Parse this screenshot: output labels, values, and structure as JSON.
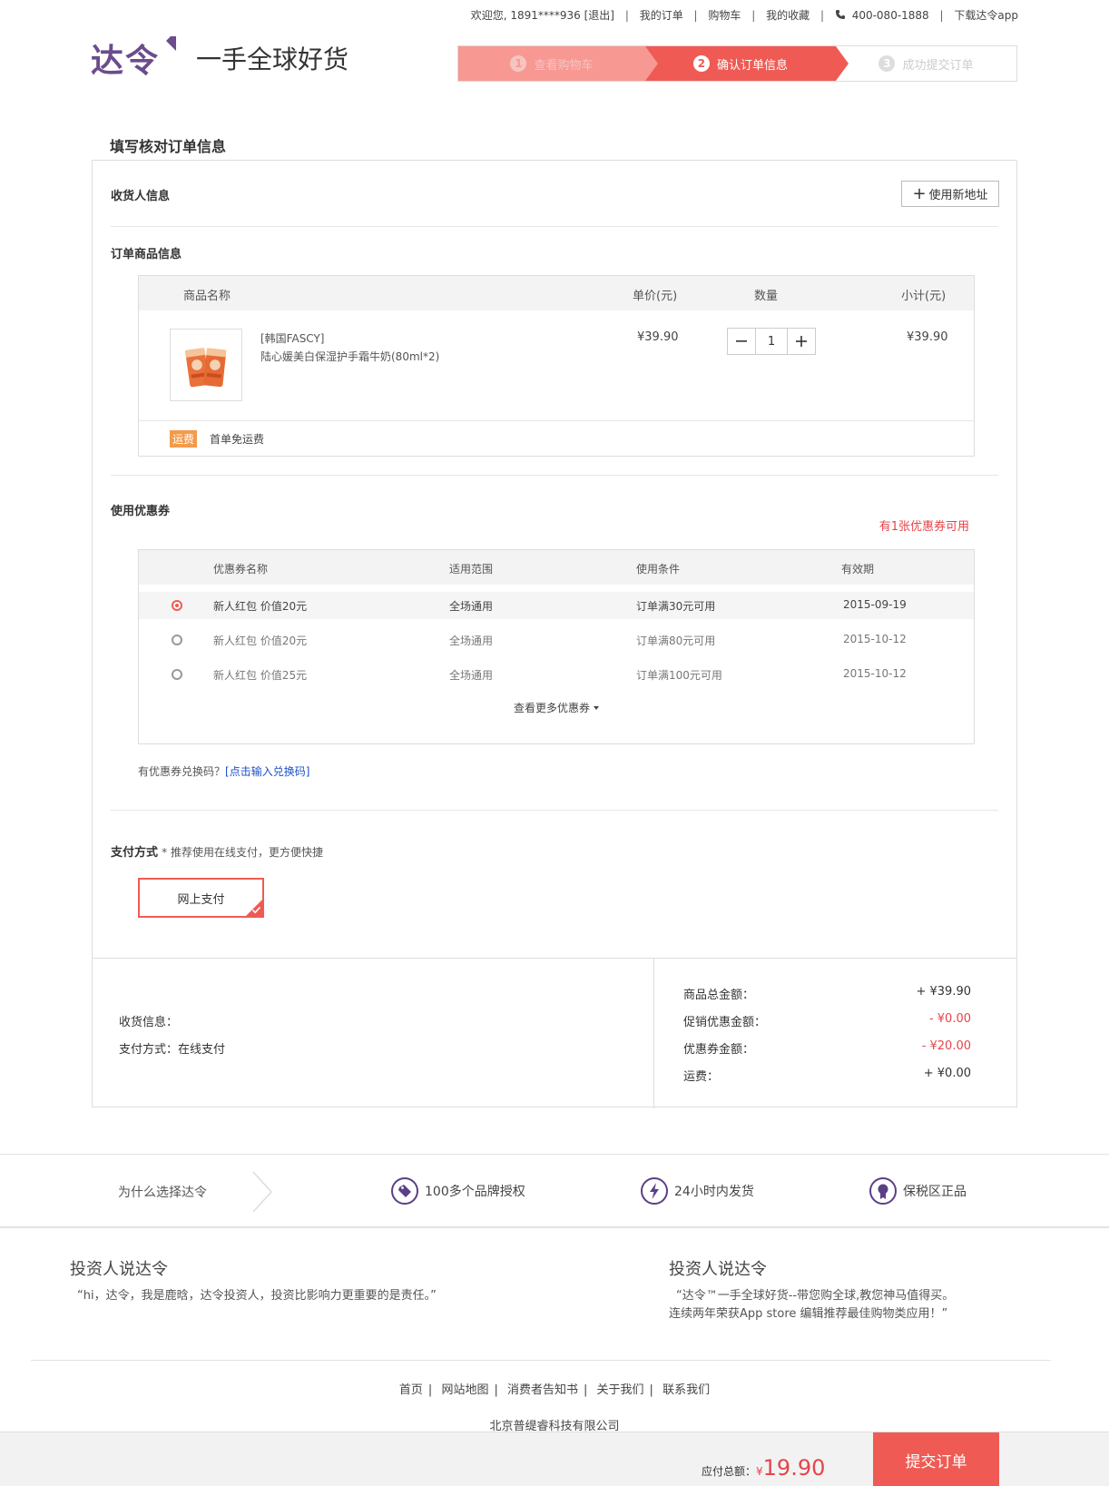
{
  "topbar": {
    "welcome": "欢迎您, 1891****936",
    "logout": "[退出]",
    "my_orders": "我的订单",
    "cart": "购物车",
    "favorites": "我的收藏",
    "phone": "400-080-1888",
    "download_app": "下载达令app"
  },
  "header": {
    "logo_text": "达令",
    "slogan": "一手全球好货",
    "steps": [
      {
        "num": "1",
        "label": "查看购物车",
        "state": "done"
      },
      {
        "num": "2",
        "label": "确认订单信息",
        "state": "active"
      },
      {
        "num": "3",
        "label": "成功提交订单",
        "state": "pending"
      }
    ]
  },
  "page_title": "填写核对订单信息",
  "consignee": {
    "label": "收货人信息",
    "new_address_button": "使用新地址"
  },
  "order_items": {
    "label": "订单商品信息",
    "columns": {
      "name": "商品名称",
      "price": "单价(元)",
      "qty": "数量",
      "subtotal": "小计(元)"
    },
    "items": [
      {
        "brand": "[韩国FASCY]",
        "name": "陆心媛美白保湿护手霜牛奶(80ml*2)",
        "price": "¥39.90",
        "qty": "1",
        "subtotal": "¥39.90"
      }
    ],
    "shipping_tag": "运费",
    "shipping_text": "首单免运费"
  },
  "coupons": {
    "label": "使用优惠券",
    "available": "有1张优惠券可用",
    "columns": {
      "name": "优惠券名称",
      "scope": "适用范围",
      "condition": "使用条件",
      "expiry": "有效期"
    },
    "rows": [
      {
        "name": "新人红包 价值20元",
        "scope": "全场通用",
        "condition": "订单满30元可用",
        "expiry": "2015-09-19",
        "selected": true
      },
      {
        "name": "新人红包 价值20元",
        "scope": "全场通用",
        "condition": "订单满80元可用",
        "expiry": "2015-10-12",
        "selected": false
      },
      {
        "name": "新人红包 价值25元",
        "scope": "全场通用",
        "condition": "订单满100元可用",
        "expiry": "2015-10-12",
        "selected": false
      }
    ],
    "more": "查看更多优惠券",
    "exchange_prompt": "有优惠券兑换码？",
    "exchange_link": "[点击输入兑换码]"
  },
  "payment": {
    "label": "支付方式",
    "hint": "* 推荐使用在线支付，更方便快捷",
    "option": "网上支付"
  },
  "summary": {
    "ship_info": "收货信息：",
    "pay_method": "支付方式：在线支付",
    "lines": [
      {
        "label": "商品总金额：",
        "value": "+ ¥39.90"
      },
      {
        "label": "促销优惠金额：",
        "value": "- ¥0.00"
      },
      {
        "label": "优惠券金额：",
        "value": "- ¥20.00"
      },
      {
        "label": "运费：",
        "value": "+ ¥0.00"
      }
    ]
  },
  "promo": {
    "why": "为什么选择达令",
    "items": [
      {
        "icon": "tag-icon",
        "label": "100多个品牌授权"
      },
      {
        "icon": "lightning-icon",
        "label": "24小时内发货"
      },
      {
        "icon": "award-icon",
        "label": "保税区正品"
      }
    ]
  },
  "investors": [
    {
      "title": "投资人说达令",
      "quote": "“hi，达令，我是鹿晗，达令投资人，投资比影响力更重要的是责任。”"
    },
    {
      "title": "投资人说达令",
      "quote_line1": "“达令™一手全球好货--带您购全球,教您神马值得买。",
      "quote_line2": "连续两年荣获App store 编辑推荐最佳购物类应用！”"
    }
  ],
  "footer": {
    "links": [
      "首页",
      "网站地图",
      "消费者告知书",
      "关于我们",
      "联系我们"
    ],
    "company": "北京普缇睿科技有限公司"
  },
  "bottom_bar": {
    "total_label": "应付总额：",
    "currency": "¥",
    "total": "19.90",
    "submit": "提交订单"
  },
  "colors": {
    "accent": "#ef5b54",
    "step_done": "#f89892",
    "brand_purple": "#6b4c8c",
    "price_red": "#e6444a",
    "link_blue": "#1e50c8"
  }
}
